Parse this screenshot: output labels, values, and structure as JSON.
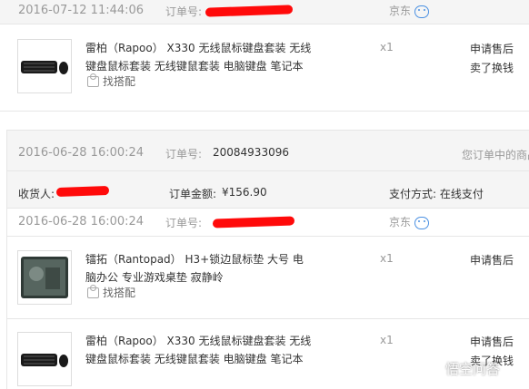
{
  "order1": {
    "time": "2016-07-12 11:44:06",
    "order_no_label": "订单号:",
    "shop": "京东",
    "item": {
      "title": "雷柏（Rapoo） X330 无线鼠标键盘套装 无线键盘鼠标套装 无线键鼠套装 电脑键盘 笔记本",
      "qty": "x1",
      "action1": "申请售后",
      "action2": "卖了换钱",
      "match": "找搭配"
    }
  },
  "order2": {
    "time": "2016-06-28 16:00:24",
    "order_no_label": "订单号:",
    "order_no": "20084933096",
    "note": "您订单中的商品",
    "receiver_label": "收货人:",
    "amount_label": "订单金额:",
    "amount": "¥156.90",
    "payment": "支付方式: 在线支付"
  },
  "order2_sub": {
    "time": "2016-06-28 16:00:24",
    "order_no_label": "订单号:",
    "shop": "京东",
    "items": [
      {
        "title": "镭拓（Rantopad） H3+锁边鼠标垫 大号 电脑办公 专业游戏桌垫 寂静岭",
        "qty": "x1",
        "action1": "申请售后",
        "match": "找搭配"
      },
      {
        "title": "雷柏（Rapoo） X330 无线鼠标键盘套装 无线键盘鼠标套装 无线键鼠套装 电脑键盘 笔记本",
        "qty": "x1",
        "action1": "申请售后",
        "action2": "卖了换钱"
      }
    ]
  },
  "watermark": "悟空问答"
}
